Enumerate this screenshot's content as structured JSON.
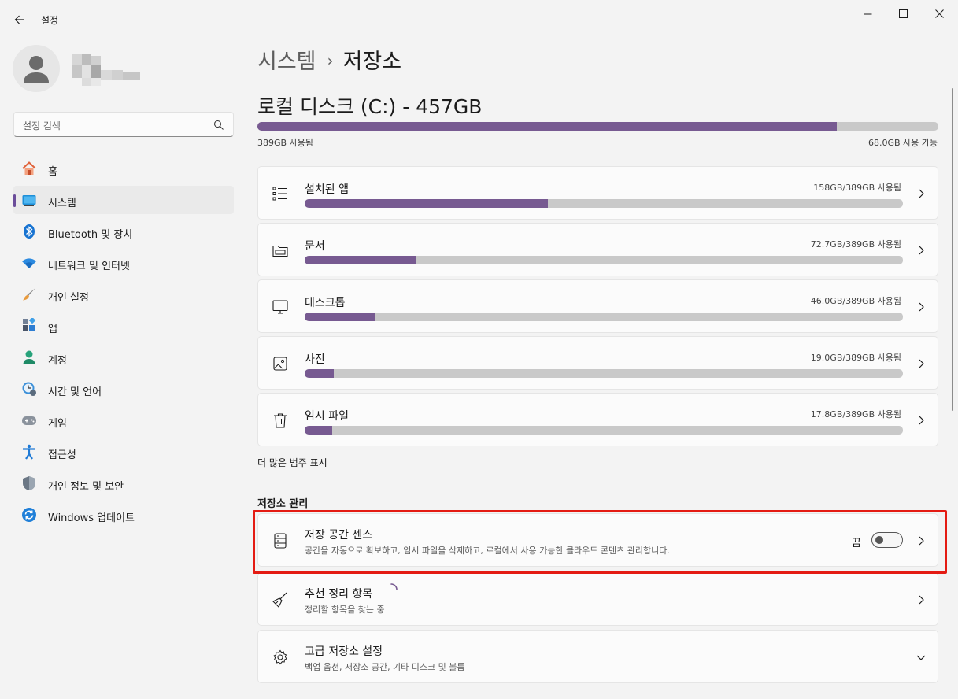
{
  "window": {
    "app_title": "설정",
    "controls": [
      "minimize-icon",
      "maximize-icon",
      "close-icon"
    ]
  },
  "sidebar": {
    "search_placeholder": "설정 검색",
    "items": [
      {
        "label": "홈",
        "icon": "home-icon",
        "active": false
      },
      {
        "label": "시스템",
        "icon": "system-icon",
        "active": true
      },
      {
        "label": "Bluetooth 및 장치",
        "icon": "bluetooth-icon",
        "active": false
      },
      {
        "label": "네트워크 및 인터넷",
        "icon": "wifi-icon",
        "active": false
      },
      {
        "label": "개인 설정",
        "icon": "brush-icon",
        "active": false
      },
      {
        "label": "앱",
        "icon": "apps-icon",
        "active": false
      },
      {
        "label": "계정",
        "icon": "account-icon",
        "active": false
      },
      {
        "label": "시간 및 언어",
        "icon": "time-language-icon",
        "active": false
      },
      {
        "label": "게임",
        "icon": "gamepad-icon",
        "active": false
      },
      {
        "label": "접근성",
        "icon": "accessibility-icon",
        "active": false
      },
      {
        "label": "개인 정보 및 보안",
        "icon": "shield-icon",
        "active": false
      },
      {
        "label": "Windows 업데이트",
        "icon": "update-icon",
        "active": false
      }
    ]
  },
  "header": {
    "parent": "시스템",
    "separator": "›",
    "current": "저장소"
  },
  "disk": {
    "title": "로컬 디스크 (C:) - 457GB",
    "used_label": "389GB 사용됨",
    "free_label": "68.0GB 사용 가능",
    "used_fraction": 0.851
  },
  "categories": [
    {
      "name": "설치된 앱",
      "value": "158GB/389GB 사용됨",
      "fraction": 0.406,
      "icon": "list-icon"
    },
    {
      "name": "문서",
      "value": "72.7GB/389GB 사용됨",
      "fraction": 0.187,
      "icon": "folder-icon"
    },
    {
      "name": "데스크톱",
      "value": "46.0GB/389GB 사용됨",
      "fraction": 0.118,
      "icon": "monitor-icon"
    },
    {
      "name": "사진",
      "value": "19.0GB/389GB 사용됨",
      "fraction": 0.049,
      "icon": "picture-icon"
    },
    {
      "name": "임시 파일",
      "value": "17.8GB/389GB 사용됨",
      "fraction": 0.046,
      "icon": "trash-icon"
    }
  ],
  "more_categories": "더 많은 범주 표시",
  "management": {
    "header": "저장소 관리",
    "storage_sense": {
      "title": "저장 공간 센스",
      "desc": "공간을 자동으로 확보하고, 임시 파일을 삭제하고, 로컬에서 사용 가능한 클라우드 콘텐츠 관리합니다.",
      "toggle_label": "끔",
      "toggle_on": false,
      "icon": "drive-icon"
    },
    "cleanup": {
      "title": "추천 정리 항목",
      "desc": "정리할 항목을 찾는 중",
      "icon": "broom-icon"
    },
    "advanced": {
      "title": "고급 저장소 설정",
      "desc": "백업 옵션, 저장소 공간, 기타 디스크 및 볼륨",
      "icon": "gear-icon"
    }
  },
  "colors": {
    "accent": "#775a91",
    "bar_track": "#c9c9c9",
    "highlight": "#e41b13"
  }
}
